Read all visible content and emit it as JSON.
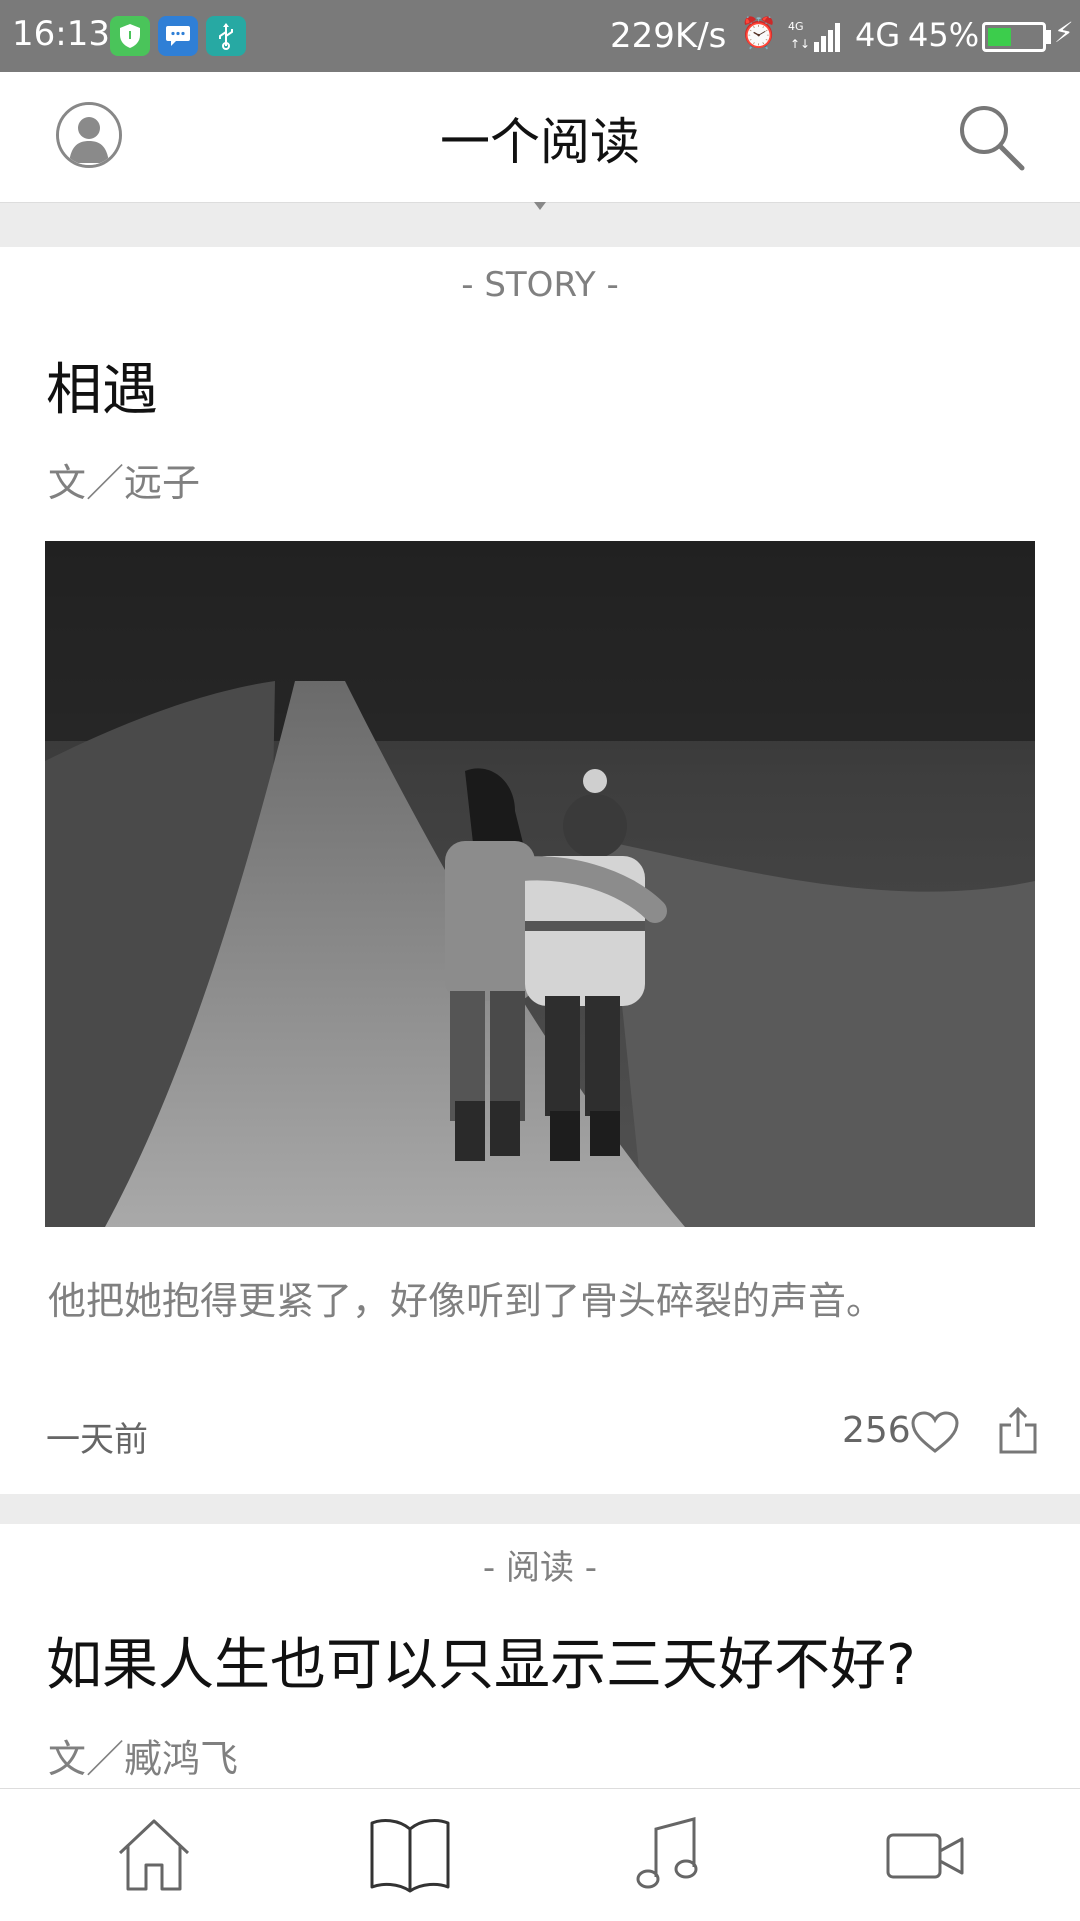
{
  "status_bar": {
    "time": "16:13",
    "speed": "229K/s",
    "network": "4G",
    "battery_percent": "45%",
    "battery_level": 0.45,
    "icons": [
      "shield-app-icon",
      "message-app-icon",
      "usb-icon",
      "alarm-icon",
      "signal-icon",
      "charging-icon"
    ]
  },
  "header": {
    "title": "一个阅读",
    "left_icon": "avatar-icon",
    "right_icon": "search-icon"
  },
  "feed": [
    {
      "category": "- STORY -",
      "title": "相遇",
      "author": "文／远子",
      "excerpt": "他把她抱得更紧了，好像听到了骨头碎裂的声音。",
      "time": "一天前",
      "likes": "256"
    },
    {
      "category": "- 阅读 -",
      "title": "如果人生也可以只显示三天好不好?",
      "author": "文／臧鸿飞"
    }
  ],
  "tab_bar": {
    "tabs": [
      "home-icon",
      "book-icon",
      "music-icon",
      "video-icon"
    ]
  },
  "colors": {
    "status_bar_bg": "#7a7a7a",
    "divider_bg": "#ececec",
    "secondary_text": "#808080",
    "battery_green": "#3ccd4c"
  }
}
